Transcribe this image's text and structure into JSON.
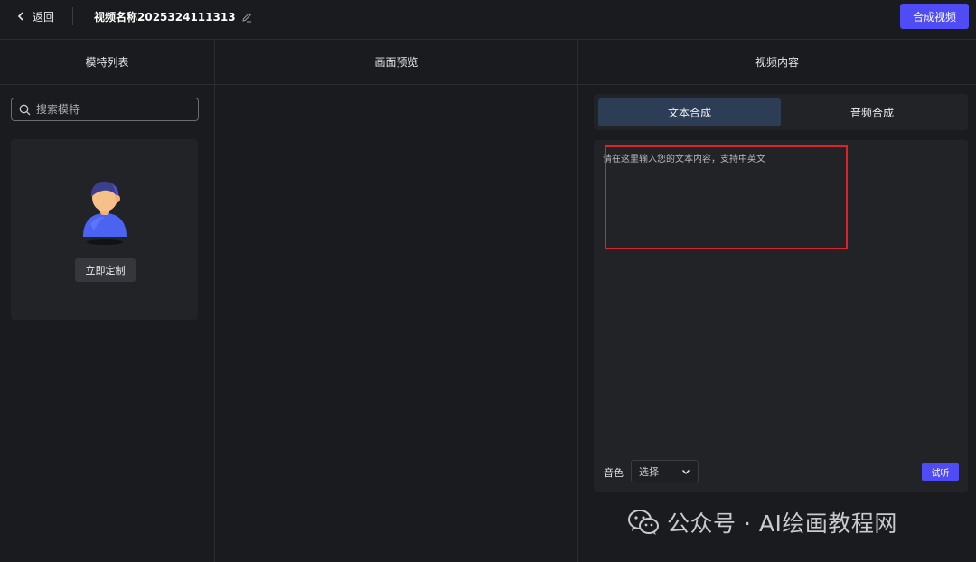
{
  "header": {
    "back_label": "返回",
    "video_title": "视频名称2025324111313",
    "compose_button": "合成视频"
  },
  "columns": {
    "models_title": "模特列表",
    "preview_title": "画面预览",
    "content_title": "视频内容"
  },
  "models": {
    "search_placeholder": "搜索模特",
    "custom_button": "立即定制"
  },
  "content": {
    "tabs": [
      {
        "label": "文本合成",
        "active": true
      },
      {
        "label": "音频合成",
        "active": false
      }
    ],
    "text_placeholder": "请在这里输入您的文本内容，支持中英文",
    "voice_label": "音色",
    "voice_select_value": "选择",
    "listen_button": "试听"
  },
  "watermark": {
    "text": "公众号 · AI绘画教程网"
  },
  "colors": {
    "accent": "#4f4cf5",
    "active_tab": "#2c3d55",
    "highlight": "#e0202a",
    "background": "#1a1b1e",
    "panel": "#222327"
  },
  "icons": [
    "chevron-left-icon",
    "edit-pencil-icon",
    "search-icon",
    "chevron-down-icon",
    "wechat-icon",
    "avatar-illustration"
  ]
}
